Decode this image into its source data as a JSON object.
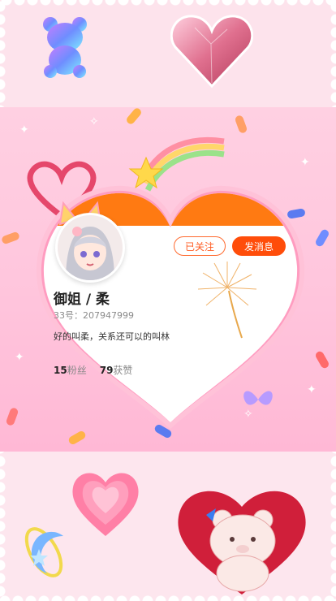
{
  "profile": {
    "follow_label": "已关注",
    "message_label": "发消息",
    "name": "御姐 / 柔",
    "uid": "33号：207947999",
    "bio": "好的叫柔，关系还可以的叫林",
    "fans_count": "15",
    "fans_label": "粉丝",
    "likes_count": "79",
    "likes_label": "获赞"
  },
  "colors": {
    "accent": "#ff4d0a",
    "banner_orange": "#ff7a12",
    "background": "#fde6ee"
  }
}
